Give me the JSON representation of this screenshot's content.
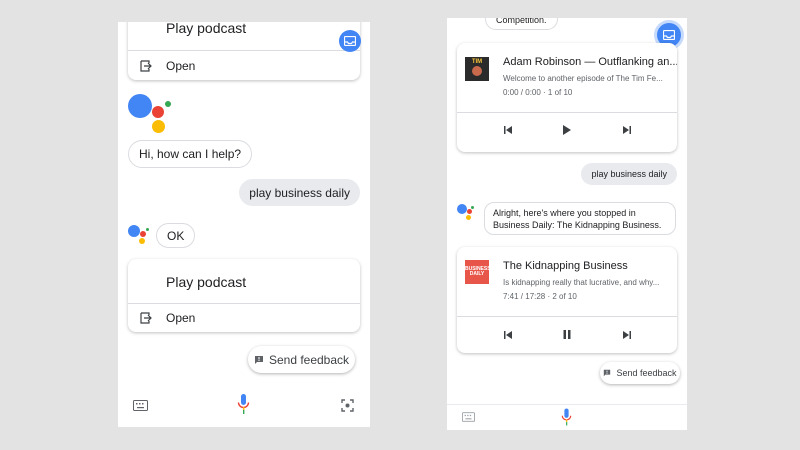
{
  "left_phone": {
    "card1": {
      "title": "Play podcast",
      "open_label": "Open"
    },
    "assistant_greeting": "Hi, how can I help?",
    "user_query": "play business daily",
    "assistant_ok": "OK",
    "card2": {
      "title": "Play podcast",
      "open_label": "Open"
    },
    "feedback_label": "Send feedback",
    "bottom_icons": [
      "keyboard-icon",
      "microphone-icon",
      "lens-icon"
    ]
  },
  "right_phone": {
    "top_partial_text": "Competition.",
    "episode1": {
      "title": "Adam Robinson — Outflanking an...",
      "description": "Welcome to another episode of The Tim Fe...",
      "time": "0:00 / 0:00 · 1 of 10",
      "thumb_label": "TIM"
    },
    "user_query": "play business daily",
    "assistant_reply": "Alright, here's where you stopped in Business Daily: The Kidnapping Business.",
    "episode2": {
      "title": "The Kidnapping Business",
      "description": "Is kidnapping really that lucrative, and why...",
      "time": "7:41 / 17:28 · 2 of 10",
      "thumb_label": "BUSINESS DAILY"
    },
    "feedback_label": "Send feedback",
    "bottom_icons": [
      "keyboard-icon",
      "microphone-icon"
    ]
  },
  "colors": {
    "google_blue": "#4285f4",
    "google_red": "#ea4335",
    "google_yellow": "#fbbc04",
    "google_green": "#34a853"
  }
}
